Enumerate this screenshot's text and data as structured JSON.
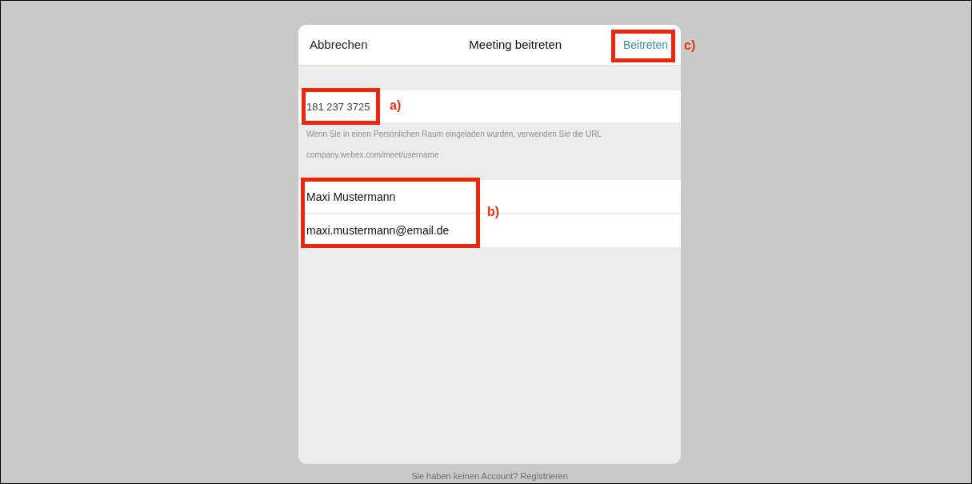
{
  "dialog": {
    "cancel": "Abbrechen",
    "title": "Meeting beitreten",
    "join": "Beitreten"
  },
  "meeting_number": {
    "value": "181 237 3725"
  },
  "hint_lines": [
    "Wenn Sie in einen Persönlichen Raum eingeladen wurden, verwenden Sie die URL",
    "company.webex.com/meet/username"
  ],
  "name_field": {
    "value": "Maxi Mustermann"
  },
  "email_field": {
    "value": "maxi.mustermann@email.de"
  },
  "footer": "Sie haben keinen Account? Registrieren",
  "annotations": [
    {
      "label": "a)"
    },
    {
      "label": "b)"
    },
    {
      "label": "c)"
    }
  ]
}
